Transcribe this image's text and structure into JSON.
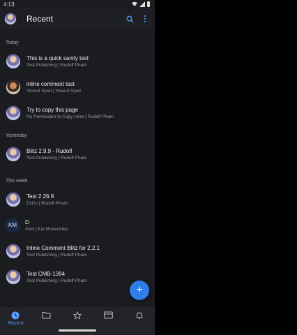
{
  "status_bar": {
    "time": "4:13"
  },
  "app_bar": {
    "title": "Recent"
  },
  "sections": [
    {
      "header": "Today",
      "items": [
        {
          "title": "This is a quick sanity test",
          "subtitle": "Test Publishing | Rudolf Pham",
          "avatar": "photo-rudolf"
        },
        {
          "title": "inline comment test",
          "subtitle": "Yousuf Syed | Yousuf Syed",
          "avatar": "photo-yousuf"
        },
        {
          "title": "Try to copy this page",
          "subtitle": "No Permission to Copy Here | Rudolf Pham",
          "avatar": "photo-rudolf"
        }
      ]
    },
    {
      "header": "Yesterday",
      "items": [
        {
          "title": "Blitz 2.9.9 - Rudolf",
          "subtitle": "Test Publishing | Rudolf Pham",
          "avatar": "photo-rudolf"
        }
      ]
    },
    {
      "header": "This week",
      "items": [
        {
          "title": "Test 2.26.9",
          "subtitle": "ExCo | Rudolf Pham",
          "avatar": "photo-rudolf"
        },
        {
          "title": "D",
          "subtitle": "Abct | Kai Munechika",
          "avatar": "initials",
          "initials": "KM"
        },
        {
          "title": "Inline Comment Blitz for 2.2.1",
          "subtitle": "Test Publishing | Rudolf Pham",
          "avatar": "photo-rudolf"
        },
        {
          "title": "Test CMB-1394",
          "subtitle": "Test Publishing | Rudolf Pham",
          "avatar": "photo-rudolf"
        }
      ]
    }
  ],
  "fab": {
    "icon": "plus-icon",
    "label": "+"
  },
  "bottom_nav": [
    {
      "icon": "clock-icon",
      "label": "Recent",
      "active": true
    },
    {
      "icon": "folder-icon",
      "label": "",
      "active": false
    },
    {
      "icon": "star-icon",
      "label": "",
      "active": false
    },
    {
      "icon": "card-icon",
      "label": "",
      "active": false
    },
    {
      "icon": "bell-icon",
      "label": "",
      "active": false
    }
  ],
  "colors": {
    "accent": "#2e7de9",
    "background": "#1b1c20",
    "active_tab": "#5ba0ff"
  }
}
